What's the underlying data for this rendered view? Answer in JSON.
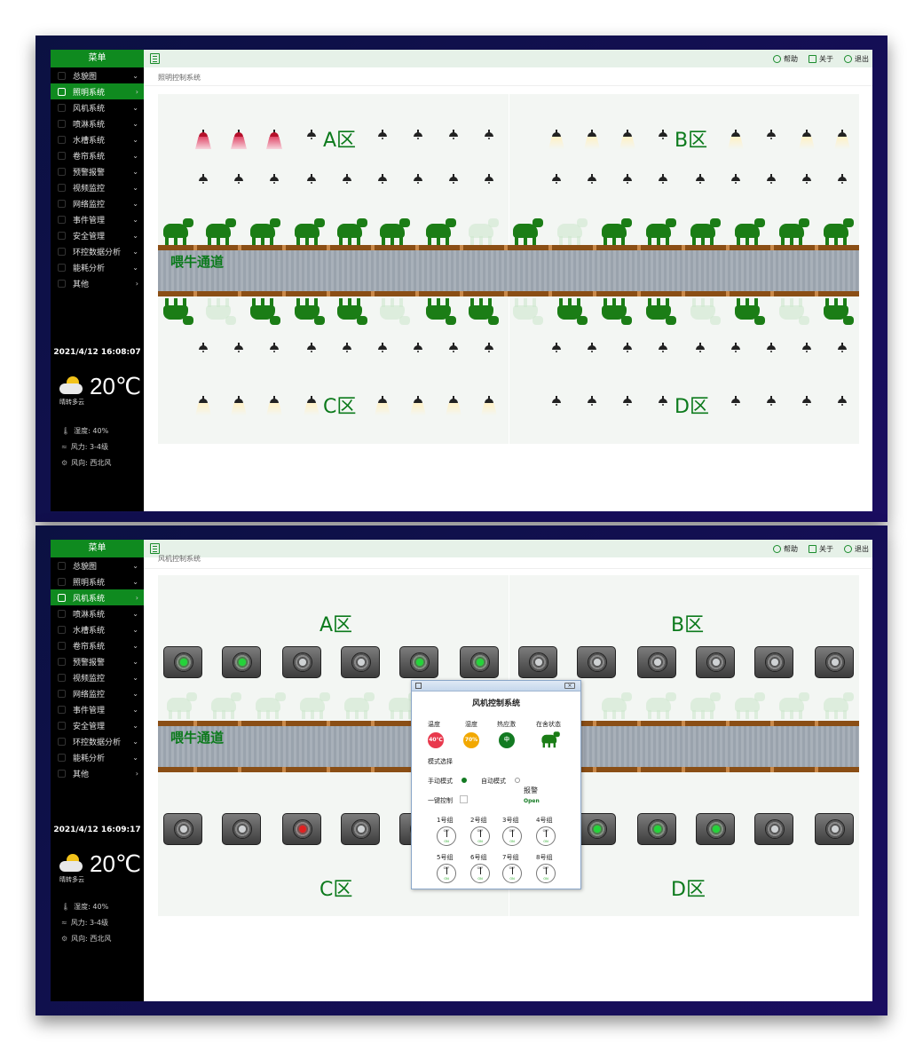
{
  "sidebar": {
    "title": "菜单",
    "items": [
      {
        "label": "总貌图",
        "chev": "⌄"
      },
      {
        "label": "照明系统",
        "chev": "›"
      },
      {
        "label": "风机系统",
        "chev": "⌄"
      },
      {
        "label": "喷淋系统",
        "chev": "⌄"
      },
      {
        "label": "水槽系统",
        "chev": "⌄"
      },
      {
        "label": "卷帘系统",
        "chev": "⌄"
      },
      {
        "label": "预警报警",
        "chev": "⌄"
      },
      {
        "label": "视频监控",
        "chev": "⌄"
      },
      {
        "label": "网络监控",
        "chev": "⌄"
      },
      {
        "label": "事件管理",
        "chev": "⌄"
      },
      {
        "label": "安全管理",
        "chev": "⌄"
      },
      {
        "label": "环控数据分析",
        "chev": "⌄"
      },
      {
        "label": "能耗分析",
        "chev": "⌄"
      },
      {
        "label": "其他",
        "chev": "›"
      }
    ],
    "weather": {
      "temp": "20℃",
      "desc": "晴转多云",
      "humidity_label": "湿度:",
      "humidity": "40%",
      "wind_label": "风力:",
      "wind": "3-4级",
      "dir_label": "风向:",
      "dir": "西北风"
    }
  },
  "topbar": {
    "help": "帮助",
    "about": "关于",
    "exit": "退出"
  },
  "screen1": {
    "breadcrumb": "照明控制系统",
    "datetime": "2021/4/12 16:08:07",
    "active_item": 1,
    "zones": {
      "a": "A区",
      "b": "B区",
      "c": "C区",
      "d": "D区"
    },
    "alley_label": "喂牛通道"
  },
  "screen2": {
    "breadcrumb": "风机控制系统",
    "datetime": "2021/4/12 16:09:17",
    "active_item": 2,
    "zones": {
      "a": "A区",
      "b": "B区",
      "c": "C区",
      "d": "D区"
    },
    "alley_label": "喂牛通道",
    "dialog": {
      "title": "风机控制系统",
      "temp_label": "温度",
      "temp_value": "40℃",
      "humidity_label": "湿度",
      "humidity_value": "70%",
      "heat_label": "热应激",
      "heat_value": "中",
      "presence_label": "在舍状态",
      "mode_label": "模式选择",
      "manual_label": "手动模式",
      "auto_label": "自动模式",
      "onekey_label": "一键控制",
      "alarm_label": "报警",
      "alarm_value": "Open",
      "groups": [
        "1号组",
        "2号组",
        "3号组",
        "4号组",
        "5号组",
        "6号组",
        "7号组",
        "8号组"
      ],
      "off_text": "OFF",
      "on_text": "ON"
    }
  },
  "colors": {
    "accent": "#0f8a1f",
    "zone_text": "#0c7a1c",
    "temp_red": "#e8394d",
    "humid_orange": "#f2a800",
    "heat_green": "#137a22"
  }
}
